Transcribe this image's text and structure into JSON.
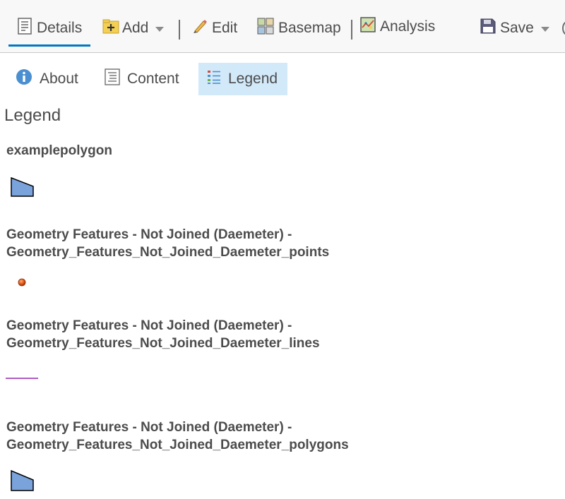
{
  "toolbar": {
    "details_label": "Details",
    "add_label": "Add",
    "edit_label": "Edit",
    "basemap_label": "Basemap",
    "analysis_label": "Analysis",
    "save_label": "Save",
    "active_item": "Details",
    "accent_color": "#0079c1"
  },
  "tabs": {
    "about_label": "About",
    "content_label": "Content",
    "legend_label": "Legend",
    "active_tab": "Legend"
  },
  "legend": {
    "heading": "Legend",
    "layers": [
      {
        "title_line1": "examplepolygon",
        "title_line2": "",
        "symbol": "polygon",
        "color": "#7aa3dc"
      },
      {
        "title_line1": "Geometry Features - Not Joined (Daemeter) -",
        "title_line2": "Geometry_Features_Not_Joined_Daemeter_points",
        "symbol": "point",
        "color": "#e85a1a"
      },
      {
        "title_line1": "Geometry Features - Not Joined (Daemeter) -",
        "title_line2": "Geometry_Features_Not_Joined_Daemeter_lines",
        "symbol": "line",
        "color": "#b05cc4"
      },
      {
        "title_line1": "Geometry Features - Not Joined (Daemeter) -",
        "title_line2": "Geometry_Features_Not_Joined_Daemeter_polygons",
        "symbol": "polygon",
        "color": "#7aa3dc"
      }
    ]
  },
  "icons": {
    "details": "details-icon",
    "add": "add-icon",
    "edit": "pencil-icon",
    "basemap": "basemap-grid-icon",
    "analysis": "analysis-map-icon",
    "save": "floppy-disk-icon",
    "about": "info-icon",
    "content": "content-list-icon",
    "legend": "legend-list-icon"
  }
}
